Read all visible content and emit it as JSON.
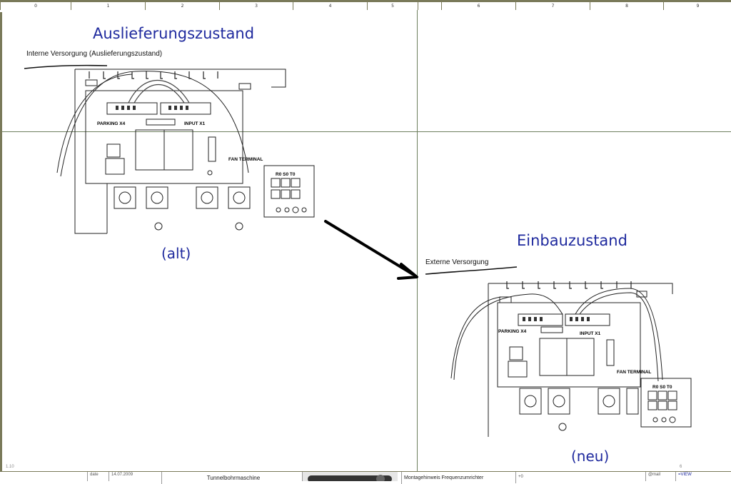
{
  "ruler": {
    "columns": [
      "0",
      "1",
      "2",
      "3",
      "4",
      "5",
      "6",
      "7",
      "8",
      "9"
    ]
  },
  "left_panel": {
    "title": "Auslieferungszustand",
    "subtitle": "Interne Versorgung (Auslieferungszustand)",
    "label_parking": "PARKING X4",
    "label_input": "INPUT X1",
    "label_fan": "FAN TERMINAL",
    "label_rst": "R0  S0  T0",
    "caption": "(alt)"
  },
  "right_panel": {
    "title": "Einbauzustand",
    "subtitle": "Externe Versorgung",
    "label_parking": "PARKING X4",
    "label_input": "INPUT X1",
    "label_fan": "FAN TERMINAL",
    "label_rst": "R0  S0  T0",
    "caption": "(neu)"
  },
  "footer": {
    "date_label": "date",
    "date_value": "14.07.2009",
    "project": "Tunnelbohrmaschine",
    "doc_title": "Montagehinweis Frequenzumrichter",
    "doc_code": "+0",
    "email_label": "@mail",
    "view_label": "=VIEW"
  },
  "corner": {
    "left_number": "1.10",
    "right_number": "6"
  },
  "colors": {
    "title_blue": "#1f2a9e",
    "grid": "#6e7f5e",
    "frame": "#7a7a5a"
  }
}
